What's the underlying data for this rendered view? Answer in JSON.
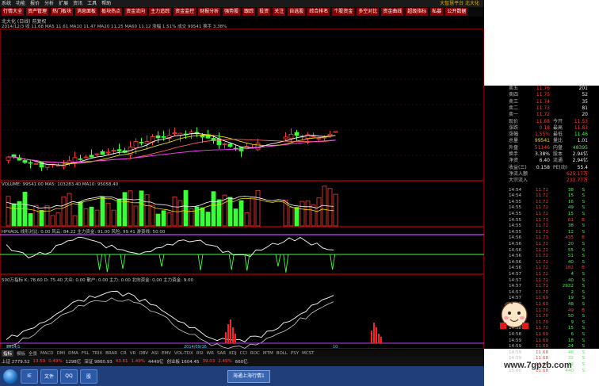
{
  "menubar": {
    "items": [
      "系统",
      "功能",
      "报价",
      "分析",
      "扩展",
      "资讯",
      "工具",
      "帮助"
    ],
    "title": "大智慧平台  北大化"
  },
  "toolbar": {
    "buttons": [
      "行情大全",
      "资产管理",
      "热门板块",
      "消息面板",
      "板块热点",
      "资金流向",
      "主力追踪",
      "资金监控",
      "财报分析",
      "强势股",
      "跟踪",
      "投资",
      "关注",
      "自选股",
      "综合排名",
      "个股资金",
      "多空对比",
      "资金曲线",
      "超级指标",
      "私募",
      "公开数据"
    ]
  },
  "chart_header": {
    "stock_line": "北大化 (日线)  前复权",
    "ma_line": "2014/12/3  收 11.68  MA5 11.61  MA10 11.47  MA20 11.25  MA60 11.12  涨幅 1.51%  成交 99541  换手 3.38%"
  },
  "price_axis": [
    "12.00",
    "11.80",
    "11.60",
    "11.40",
    "11.20",
    "11.00",
    "10.80",
    "10.60",
    "10.40",
    "10.20",
    "10.00"
  ],
  "volume_label": "VOLUME: 99541.00  MA5: 103283.40  MA10: 95058.40",
  "kdj_label": "HPVAOL 线形对比: 0.00  风云: 84.22  主力资金: 91.00  风险: 99.41  游资线: 50.00",
  "macd_label": "500万指标  K: 78.60  D: 75.40  大众: 0.00  散户: 0.00  主力: 0.00  北向资金: 0.00  主力资金: 9.00",
  "bottom_tabs": [
    "指标",
    "模板",
    "全景",
    "MACD",
    "DMI",
    "DMA",
    "FSL",
    "TRIX",
    "BRAR",
    "CR",
    "VR",
    "OBV",
    "ASI",
    "EMV",
    "VOL-TDX",
    "RSI",
    "WR",
    "SAR",
    "KDJ",
    "CCI",
    "ROC",
    "MTM",
    "BOLL",
    "PSY",
    "MCST"
  ],
  "statusbar": [
    {
      "t": "上证 2779.52",
      "c": ""
    },
    {
      "t": "13.59",
      "c": "up"
    },
    {
      "t": "0.49%",
      "c": "up"
    },
    {
      "t": "1298亿",
      "c": ""
    },
    {
      "t": "深证 9860.93",
      "c": ""
    },
    {
      "t": "43.61",
      "c": "up"
    },
    {
      "t": "1.49%",
      "c": "up"
    },
    {
      "t": "4449亿",
      "c": ""
    },
    {
      "t": "创业板 1604.45",
      "c": ""
    },
    {
      "t": "39.03",
      "c": "up"
    },
    {
      "t": "2.49%",
      "c": "up"
    },
    {
      "t": "660亿",
      "c": ""
    }
  ],
  "taskbar": {
    "apps": [
      "IE",
      "文件",
      "QQ",
      "股"
    ],
    "task": "海通上海行情1"
  },
  "quote_panel": [
    {
      "k": "卖五",
      "v": "11.76",
      "vc": "red",
      "k2": "",
      "v2": "201",
      "v2c": "wht"
    },
    {
      "k": "卖四",
      "v": "11.75",
      "vc": "red",
      "k2": "",
      "v2": "52",
      "v2c": "wht"
    },
    {
      "k": "卖三",
      "v": "11.74",
      "vc": "red",
      "k2": "",
      "v2": "35",
      "v2c": "wht"
    },
    {
      "k": "卖二",
      "v": "11.73",
      "vc": "red",
      "k2": "",
      "v2": "81",
      "v2c": "wht"
    },
    {
      "k": "卖一",
      "v": "11.72",
      "vc": "red",
      "k2": "",
      "v2": "20",
      "v2c": "wht"
    },
    {
      "k": "现价",
      "v": "11.68",
      "vc": "red",
      "k2": "今开",
      "v2": "11.53",
      "v2c": "red"
    },
    {
      "k": "涨跌",
      "v": "0.18",
      "vc": "red",
      "k2": "最高",
      "v2": "11.83",
      "v2c": "red"
    },
    {
      "k": "涨幅",
      "v": "1.55%",
      "vc": "red",
      "k2": "最低",
      "v2": "11.46",
      "v2c": "green"
    },
    {
      "k": "总量",
      "v": "99541",
      "vc": "yel",
      "k2": "量比",
      "v2": "1.01",
      "v2c": "wht"
    },
    {
      "k": "外盘",
      "v": "51146",
      "vc": "red",
      "k2": "内盘",
      "v2": "48395",
      "v2c": "green"
    },
    {
      "k": "换手",
      "v": "3.38%",
      "vc": "wht",
      "k2": "股本",
      "v2": "2.94亿",
      "v2c": "wht"
    },
    {
      "k": "净资",
      "v": "6.40",
      "vc": "wht",
      "k2": "流通",
      "v2": "2.94亿",
      "v2c": "wht"
    },
    {
      "k": "收益(三)",
      "v": "0.158",
      "vc": "wht",
      "k2": "PE(动)",
      "v2": "55.4",
      "v2c": "wht"
    },
    {
      "k": "净流入额",
      "v": "",
      "vc": "",
      "k2": "",
      "v2": "625.17万",
      "v2c": "red"
    },
    {
      "k": "大宗流入",
      "v": "",
      "vc": "",
      "k2": "",
      "v2": "231.77万",
      "v2c": "red"
    }
  ],
  "ticks": [
    {
      "t": "14:54",
      "p": "11.72",
      "q": "38",
      "f": "S"
    },
    {
      "t": "14:54",
      "p": "11.72",
      "q": "15",
      "f": "S"
    },
    {
      "t": "14:55",
      "p": "11.72",
      "q": "16",
      "f": "S"
    },
    {
      "t": "14:55",
      "p": "11.72",
      "q": "49",
      "f": "S"
    },
    {
      "t": "14:55",
      "p": "11.72",
      "q": "15",
      "f": "S"
    },
    {
      "t": "14:55",
      "p": "11.73",
      "q": "61",
      "f": "B"
    },
    {
      "t": "14:55",
      "p": "11.72",
      "q": "38",
      "f": "S"
    },
    {
      "t": "14:55",
      "p": "11.72",
      "q": "12",
      "f": "S"
    },
    {
      "t": "14:56",
      "p": "11.73",
      "q": "435",
      "f": "B"
    },
    {
      "t": "14:56",
      "p": "11.72",
      "q": "20",
      "f": "S"
    },
    {
      "t": "14:56",
      "p": "11.72",
      "q": "55",
      "f": "S"
    },
    {
      "t": "14:56",
      "p": "11.72",
      "q": "51",
      "f": "S"
    },
    {
      "t": "14:56",
      "p": "11.72",
      "q": "40",
      "f": "S"
    },
    {
      "t": "14:56",
      "p": "11.72",
      "q": "182",
      "f": "B"
    },
    {
      "t": "14:57",
      "p": "11.72",
      "q": "4",
      "f": "S"
    },
    {
      "t": "14:57",
      "p": "11.72",
      "q": "40",
      "f": "S"
    },
    {
      "t": "14:57",
      "p": "11.71",
      "q": "2922",
      "f": "S"
    },
    {
      "t": "14:57",
      "p": "11.70",
      "q": "2",
      "f": "S"
    },
    {
      "t": "14:57",
      "p": "11.69",
      "q": "19",
      "f": "S"
    },
    {
      "t": "14:58",
      "p": "11.69",
      "q": "48",
      "f": "S"
    },
    {
      "t": "14:58",
      "p": "11.70",
      "q": "49",
      "f": "B"
    },
    {
      "t": "14:58",
      "p": "11.70",
      "q": "50",
      "f": "S"
    },
    {
      "t": "14:58",
      "p": "11.70",
      "q": "9",
      "f": "S"
    },
    {
      "t": "14:58",
      "p": "11.70",
      "q": "15",
      "f": "S"
    },
    {
      "t": "14:58",
      "p": "11.69",
      "q": "6",
      "f": "S"
    },
    {
      "t": "14:59",
      "p": "11.69",
      "q": "18",
      "f": "S"
    },
    {
      "t": "14:59",
      "p": "11.69",
      "q": "24",
      "f": "S"
    },
    {
      "t": "14:59",
      "p": "11.68",
      "q": "46",
      "f": "S"
    },
    {
      "t": "14:59",
      "p": "11.68",
      "q": "22",
      "f": "S"
    },
    {
      "t": "14:59",
      "p": "11.68",
      "q": "19",
      "f": "S"
    },
    {
      "t": "15:00",
      "p": "11.68",
      "q": "440",
      "f": "S"
    }
  ],
  "watermark": "www.7gpzb.com",
  "colors": {
    "up": "#ff3b3b",
    "down": "#38ff38",
    "ma5": "#ffffff",
    "ma10": "#f0e000",
    "ma20": "#ff40ff",
    "grid": "#7a0000"
  }
}
